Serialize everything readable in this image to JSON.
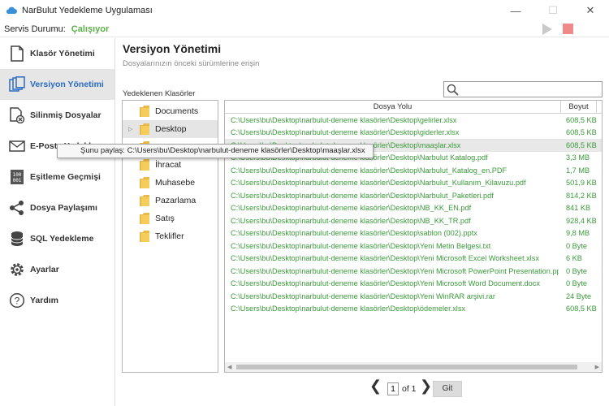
{
  "window": {
    "title": "NarBulut Yedekleme Uygulaması",
    "minimize": "—",
    "maximize": "☐",
    "close": "✕"
  },
  "status": {
    "label": "Servis Durumu:",
    "value": "Çalışıyor"
  },
  "sidebar": {
    "items": [
      {
        "label": "Klasör Yönetimi",
        "icon": "document-icon"
      },
      {
        "label": "Versiyon Yönetimi",
        "icon": "copies-icon",
        "active": true
      },
      {
        "label": "Silinmiş Dosyalar",
        "icon": "deleted-file-icon"
      },
      {
        "label": "E-Posta Yedekle",
        "icon": "envelope-icon"
      },
      {
        "label": "Eşitleme Geçmişi",
        "icon": "binary-icon"
      },
      {
        "label": "Dosya Paylaşımı",
        "icon": "share-icon"
      },
      {
        "label": "SQL Yedekleme",
        "icon": "database-icon"
      },
      {
        "label": "Ayarlar",
        "icon": "gear-icon"
      },
      {
        "label": "Yardım",
        "icon": "question-icon"
      }
    ]
  },
  "main": {
    "title": "Versiyon Yönetimi",
    "subtitle": "Dosyalarınızın önceki sürümlerine erişin",
    "folders_label": "Yedeklenen Klasörler",
    "search_placeholder": ""
  },
  "tree": [
    {
      "name": "Documents",
      "expandable": false
    },
    {
      "name": "Desktop",
      "expandable": true,
      "selected": true
    },
    {
      "name": "",
      "expandable": false
    },
    {
      "name": "İhracat",
      "expandable": false
    },
    {
      "name": "Muhasebe",
      "expandable": false
    },
    {
      "name": "Pazarlama",
      "expandable": false
    },
    {
      "name": "Satış",
      "expandable": false
    },
    {
      "name": "Teklifler",
      "expandable": false
    }
  ],
  "table": {
    "columns": [
      "Dosya Yolu",
      "Boyut"
    ],
    "rows": [
      {
        "path": "C:\\Users\\bu\\Desktop\\narbulut-deneme klasörler\\Desktop\\gelirler.xlsx",
        "size": "608,5 KB"
      },
      {
        "path": "C:\\Users\\bu\\Desktop\\narbulut-deneme klasörler\\Desktop\\giderler.xlsx",
        "size": "608,5 KB"
      },
      {
        "path": "C:\\Users\\bu\\Desktop\\narbulut-deneme klasörler\\Desktop\\maaşlar.xlsx",
        "size": "608,5 KB",
        "selected": true
      },
      {
        "path": "C:\\Users\\bu\\Desktop\\narbulut-deneme klasörler\\Desktop\\Narbulut Katalog.pdf",
        "size": "3,3 MB"
      },
      {
        "path": "C:\\Users\\bu\\Desktop\\narbulut-deneme klasörler\\Desktop\\Narbulut_Katalog_en.PDF",
        "size": "1,7 MB"
      },
      {
        "path": "C:\\Users\\bu\\Desktop\\narbulut-deneme klasörler\\Desktop\\Narbulut_Kullanım_Kilavuzu.pdf",
        "size": "501,9 KB"
      },
      {
        "path": "C:\\Users\\bu\\Desktop\\narbulut-deneme klasörler\\Desktop\\Narbulut_Paketleri.pdf",
        "size": "814,2 KB"
      },
      {
        "path": "C:\\Users\\bu\\Desktop\\narbulut-deneme klasörler\\Desktop\\NB_KK_EN.pdf",
        "size": "841 KB"
      },
      {
        "path": "C:\\Users\\bu\\Desktop\\narbulut-deneme klasörler\\Desktop\\NB_KK_TR.pdf",
        "size": "928,4 KB"
      },
      {
        "path": "C:\\Users\\bu\\Desktop\\narbulut-deneme klasörler\\Desktop\\sablon (002).pptx",
        "size": "9,8 MB"
      },
      {
        "path": "C:\\Users\\bu\\Desktop\\narbulut-deneme klasörler\\Desktop\\Yeni Metin Belgesi.txt",
        "size": "0 Byte"
      },
      {
        "path": "C:\\Users\\bu\\Desktop\\narbulut-deneme klasörler\\Desktop\\Yeni Microsoft Excel Worksheet.xlsx",
        "size": "6 KB"
      },
      {
        "path": "C:\\Users\\bu\\Desktop\\narbulut-deneme klasörler\\Desktop\\Yeni Microsoft PowerPoint Presentation.pptx",
        "size": "0 Byte"
      },
      {
        "path": "C:\\Users\\bu\\Desktop\\narbulut-deneme klasörler\\Desktop\\Yeni Microsoft Word Document.docx",
        "size": "0 Byte"
      },
      {
        "path": "C:\\Users\\bu\\Desktop\\narbulut-deneme klasörler\\Desktop\\Yeni WinRAR arşivi.rar",
        "size": "24 Byte"
      },
      {
        "path": "C:\\Users\\bu\\Desktop\\narbulut-deneme klasörler\\Desktop\\ödemeler.xlsx",
        "size": "608,5 KB"
      }
    ]
  },
  "tooltip": {
    "text": "Şunu paylaş: C:\\Users\\bu\\Desktop\\narbulut-deneme klasörler\\Desktop\\maaşlar.xlsx"
  },
  "pager": {
    "prev": "❮",
    "page": "1",
    "of": "of 1",
    "next": "❯",
    "go": "Git"
  },
  "colors": {
    "accent": "#2a6bc2",
    "status_ok": "#5cb04a",
    "file_text": "#3a9a3a",
    "stop": "#f08a8a"
  }
}
